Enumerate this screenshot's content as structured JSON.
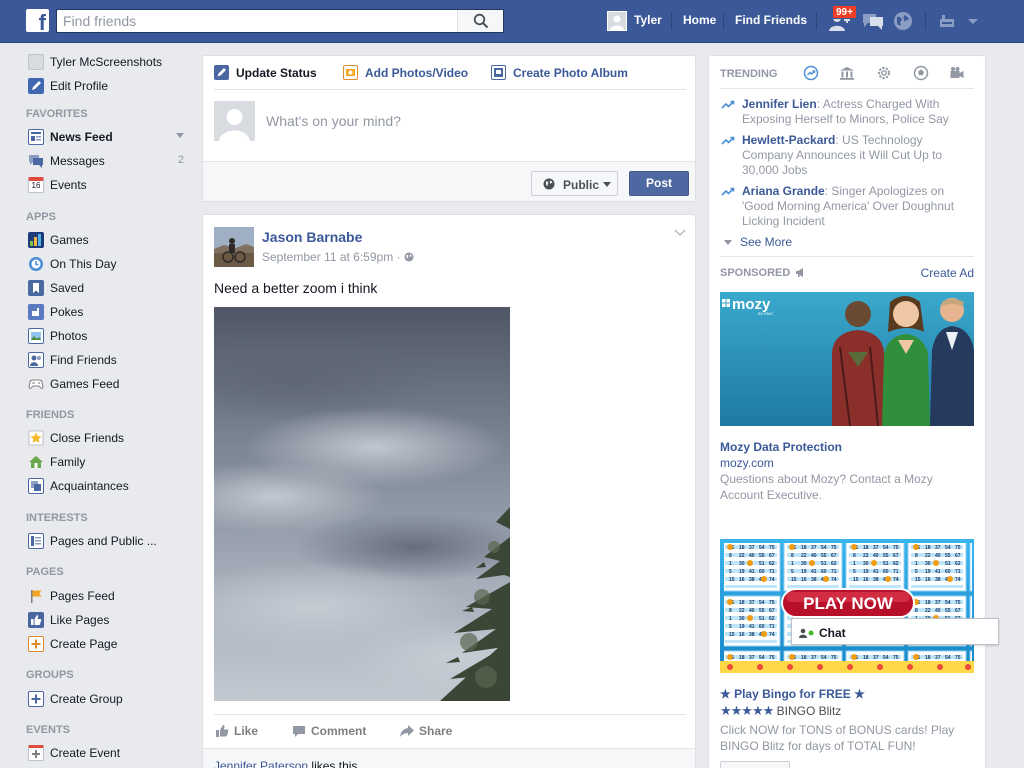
{
  "topbar": {
    "search_placeholder": "Find friends",
    "user_name": "Tyler",
    "home_label": "Home",
    "find_friends_label": "Find Friends",
    "requests_badge": "99+"
  },
  "leftnav": {
    "profile_name": "Tyler McScreenshots",
    "edit_profile": "Edit Profile",
    "sections": [
      {
        "title": "FAVORITES",
        "items": [
          {
            "label": "News Feed"
          },
          {
            "label": "Messages",
            "count": "2"
          },
          {
            "label": "Events"
          }
        ]
      },
      {
        "title": "APPS",
        "items": [
          {
            "label": "Games"
          },
          {
            "label": "On This Day"
          },
          {
            "label": "Saved"
          },
          {
            "label": "Pokes"
          },
          {
            "label": "Photos"
          },
          {
            "label": "Find Friends"
          },
          {
            "label": "Games Feed"
          }
        ]
      },
      {
        "title": "FRIENDS",
        "items": [
          {
            "label": "Close Friends"
          },
          {
            "label": "Family"
          },
          {
            "label": "Acquaintances"
          }
        ]
      },
      {
        "title": "INTERESTS",
        "items": [
          {
            "label": "Pages and Public ..."
          }
        ]
      },
      {
        "title": "PAGES",
        "items": [
          {
            "label": "Pages Feed"
          },
          {
            "label": "Like Pages"
          },
          {
            "label": "Create Page"
          }
        ]
      },
      {
        "title": "GROUPS",
        "items": [
          {
            "label": "Create Group"
          }
        ]
      },
      {
        "title": "EVENTS",
        "items": [
          {
            "label": "Create Event"
          }
        ]
      }
    ],
    "events_calendar_day": "16"
  },
  "composer": {
    "tabs": [
      {
        "label": "Update Status"
      },
      {
        "label": "Add Photos/Video"
      },
      {
        "label": "Create Photo Album"
      }
    ],
    "placeholder": "What's on your mind?",
    "audience": "Public",
    "post_button": "Post"
  },
  "post": {
    "author": "Jason Barnabe",
    "timestamp": "September 11 at 6:59pm",
    "meta_separator": "·",
    "text": "Need a better zoom i think",
    "actions": [
      {
        "label": "Like"
      },
      {
        "label": "Comment"
      },
      {
        "label": "Share"
      }
    ],
    "likes_name": "Jennifer Paterson",
    "likes_suffix": " likes this."
  },
  "trending": {
    "title": "TRENDING",
    "items": [
      {
        "name": "Jennifer Lien",
        "text": ": Actress Charged With Exposing Herself to Minors, Police Say"
      },
      {
        "name": "Hewlett-Packard",
        "text": ": US Technology Company Announces it Will Cut Up to 30,000 Jobs"
      },
      {
        "name": "Ariana Grande",
        "text": ": Singer Apologizes on 'Good Morning America' Over Doughnut Licking Incident"
      }
    ],
    "see_more": "See More"
  },
  "sponsored": {
    "title": "SPONSORED",
    "create_ad": "Create Ad",
    "ads": [
      {
        "logo": "mozy",
        "logo_sub": "BY EMC",
        "title": "Mozy Data Protection",
        "url": "mozy.com",
        "body": "Questions about Mozy? Contact a Mozy Account Executive."
      },
      {
        "banner": "PLAY NOW",
        "title": "★ Play Bingo for FREE ★",
        "stars": "★★★★★",
        "app_name": "BINGO Blitz",
        "body": "Click NOW for TONS of BONUS cards! Play BINGO Blitz for days of TOTAL FUN!"
      }
    ]
  },
  "chat": {
    "label": "Chat"
  },
  "colors": {
    "brand_blue": "#3b5998",
    "link_blue": "#3b5998",
    "page_bg": "#e9eaed",
    "muted": "#9197a3",
    "badge_red": "#f03d25",
    "post_button": "#4e69a2"
  }
}
